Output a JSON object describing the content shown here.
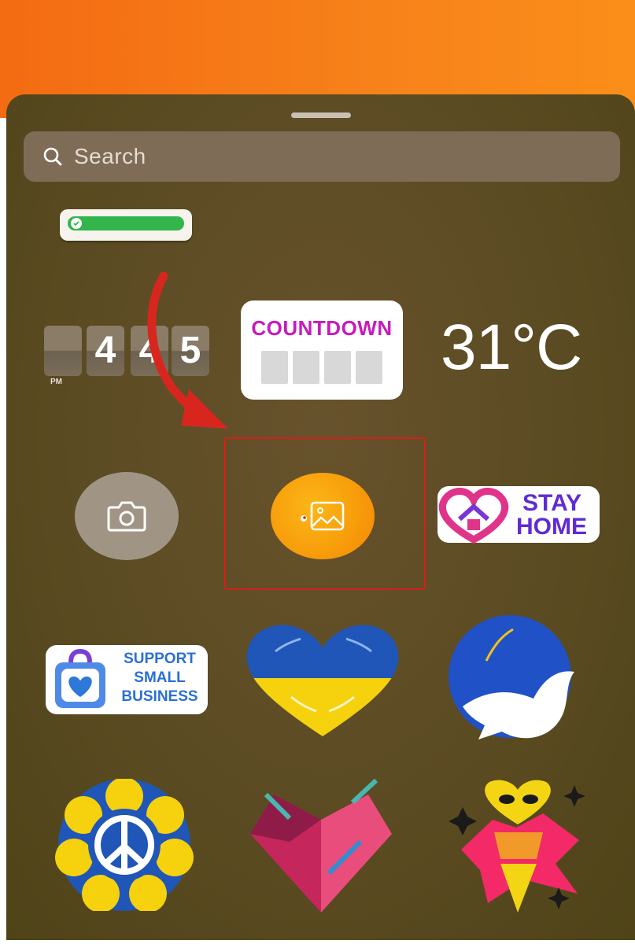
{
  "search": {
    "placeholder": "Search"
  },
  "time_sticker": {
    "digits": [
      "",
      "4",
      "4",
      "5"
    ],
    "period": "PM"
  },
  "countdown_sticker": {
    "label": "COUNTDOWN"
  },
  "temperature_sticker": {
    "value": "31°C"
  },
  "stay_home_sticker": {
    "line1": "STAY",
    "line2": "HOME"
  },
  "support_sticker": {
    "line1": "SUPPORT",
    "line2": "SMALL",
    "line3": "BUSINESS"
  },
  "colors": {
    "header_orange": "#f7821a",
    "sheet_brown": "#5b4b22",
    "highlight_red": "#d62018",
    "photo_orange": "#f89e0b",
    "countdown_magenta": "#c61bbd"
  },
  "icons": [
    "search-icon",
    "check-icon",
    "camera-icon",
    "image-icon",
    "arrow-annotation"
  ]
}
